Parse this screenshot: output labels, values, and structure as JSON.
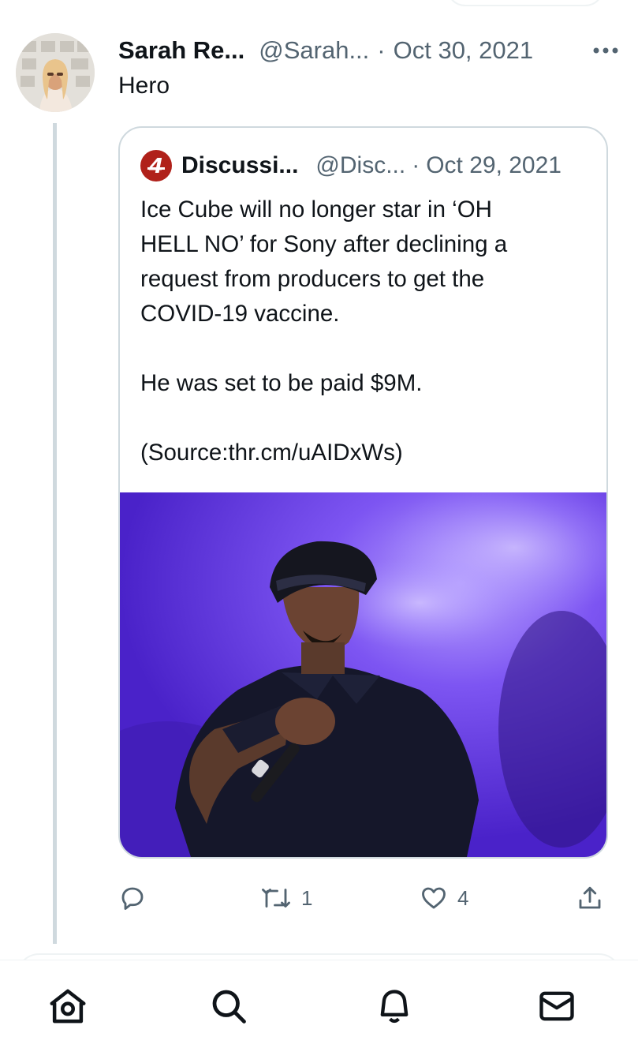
{
  "tweet": {
    "author_name": "Sarah Re...",
    "author_handle": "@Sarah...",
    "separator": "·",
    "date": "Oct 30, 2021",
    "text": "Hero"
  },
  "quote": {
    "author_name": "Discussi...",
    "author_handle": "@Disc...",
    "separator": "·",
    "date": "Oct 29, 2021",
    "logo_glyph": "4",
    "lines": [
      "Ice Cube will no longer star in ‘OH",
      "HELL NO’ for Sony after declining a",
      "request from producers to get the",
      "COVID-19 vaccine."
    ],
    "line2": "He was set to be paid $9M.",
    "line3": "(Source:thr.cm/uAIDxWs)"
  },
  "actions": {
    "reply_count": "",
    "retweet_count": "1",
    "like_count": "4"
  },
  "nav": {
    "items": [
      "home-icon",
      "search-icon",
      "notifications-icon",
      "messages-icon"
    ]
  },
  "colors": {
    "text_primary": "#0f1419",
    "text_secondary": "#536471",
    "border": "#cfd9de",
    "logo_red": "#b0211a",
    "media_purple": "#6a3df0"
  }
}
